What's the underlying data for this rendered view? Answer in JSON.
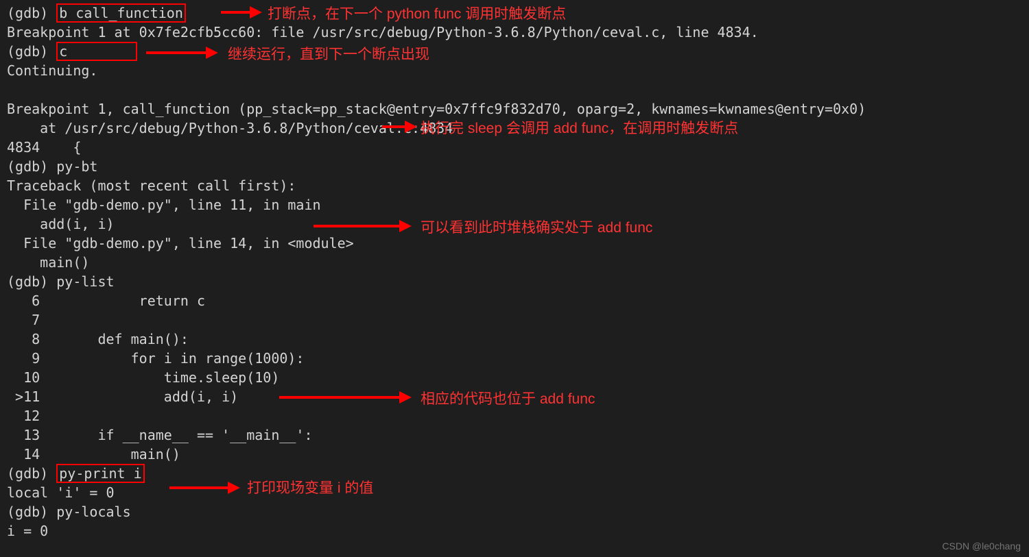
{
  "terminal": {
    "gdb_prompt": "(gdb) ",
    "line1_cmd": "b call_function",
    "line2": "Breakpoint 1 at 0x7fe2cfb5cc60: file /usr/src/debug/Python-3.6.8/Python/ceval.c, line 4834.",
    "line3_cmd": "c",
    "line4": "Continuing.",
    "line5_blank": "",
    "line6": "Breakpoint 1, call_function (pp_stack=pp_stack@entry=0x7ffc9f832d70, oparg=2, kwnames=kwnames@entry=0x0)",
    "line7": "    at /usr/src/debug/Python-3.6.8/Python/ceval.c:4834",
    "line8": "4834    {",
    "line9_cmd": "py-bt",
    "line10": "Traceback (most recent call first):",
    "line11": "  File \"gdb-demo.py\", line 11, in main",
    "line12": "    add(i, i)",
    "line13": "  File \"gdb-demo.py\", line 14, in <module>",
    "line14": "    main()",
    "line15_cmd": "py-list",
    "line16": "   6            return c",
    "line17": "   7    ",
    "line18": "   8       def main():",
    "line19": "   9           for i in range(1000):",
    "line20": "  10               time.sleep(10)",
    "line21": " >11               add(i, i)",
    "line22": "  12    ",
    "line23": "  13       if __name__ == '__main__':",
    "line24": "  14           main()",
    "line25_cmd": "py-print i",
    "line26": "local 'i' = 0",
    "line27_cmd": "py-locals",
    "line28": "i = 0"
  },
  "annotations": {
    "anno1": "打断点，在下一个 python func 调用时触发断点",
    "anno2": "继续运行，直到下一个断点出现",
    "anno3": "执行完 sleep 会调用 add func，在调用时触发断点",
    "anno4": "可以看到此时堆栈确实处于 add func",
    "anno5": "相应的代码也位于 add func",
    "anno6": "打印现场变量 i 的值"
  },
  "watermark": "CSDN @le0chang"
}
